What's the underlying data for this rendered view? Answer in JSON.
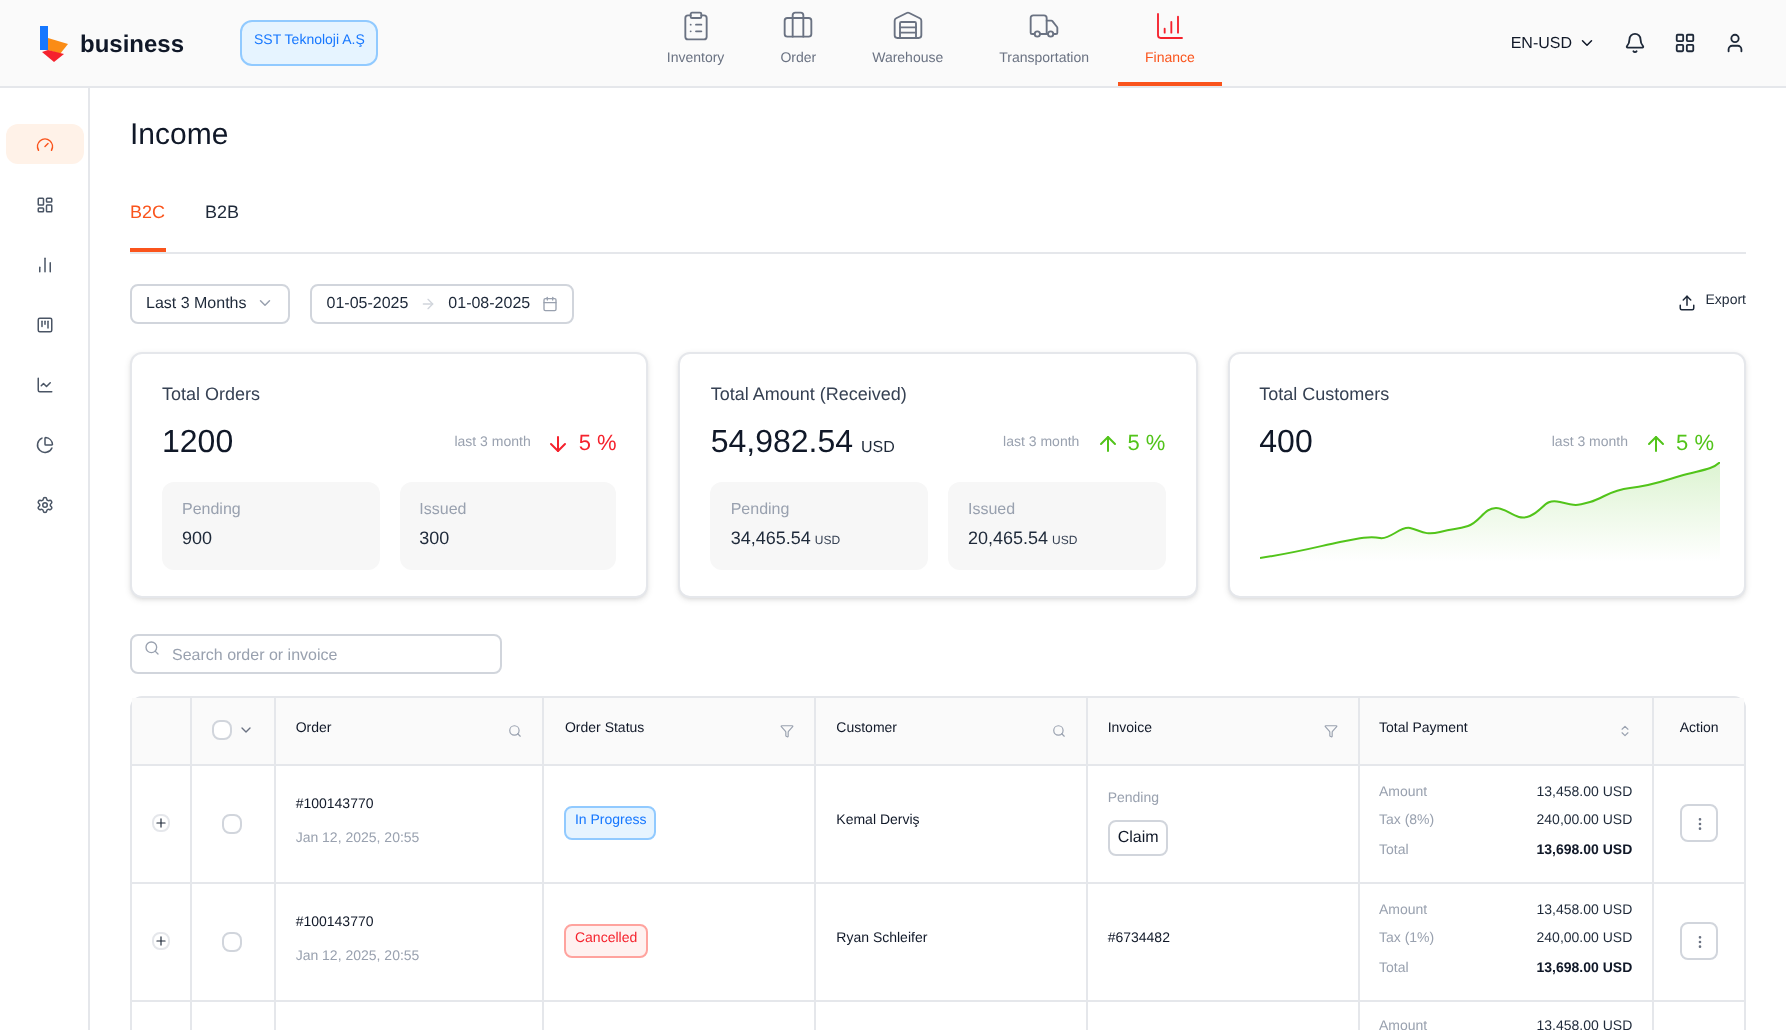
{
  "brand": {
    "name": "business",
    "company": "SST Teknoloji A.Ş"
  },
  "nav": [
    {
      "label": "Inventory",
      "selected": false
    },
    {
      "label": "Order",
      "selected": false
    },
    {
      "label": "Warehouse",
      "selected": false
    },
    {
      "label": "Transportation",
      "selected": false
    },
    {
      "label": "Finance",
      "selected": true
    }
  ],
  "locale": "EN-USD",
  "sidebar": {
    "items": [
      {
        "selected": true
      },
      {
        "selected": false
      },
      {
        "selected": false
      },
      {
        "selected": false
      },
      {
        "selected": false
      },
      {
        "selected": false
      },
      {
        "selected": false
      }
    ]
  },
  "page_title": "Income",
  "tabs": [
    {
      "label": "B2C",
      "selected": true
    },
    {
      "label": "B2B",
      "selected": false
    }
  ],
  "filters": {
    "period": "Last 3 Months",
    "date_from": "01-05-2025",
    "date_to": "01-08-2025",
    "export": "Export"
  },
  "cards": [
    {
      "title": "Total Orders",
      "value": "1200",
      "period": "last 3 month",
      "change": {
        "kind": "down",
        "text": "5 %"
      },
      "kind": "stats",
      "stats": [
        {
          "label": "Pending",
          "value": "900"
        },
        {
          "label": "Issued",
          "value": "300"
        }
      ]
    },
    {
      "title": "Total Amount (Received)",
      "value": "54,982.54",
      "unit": "USD",
      "period": "last 3 month",
      "change": {
        "kind": "up",
        "text": "5 %"
      },
      "kind": "stats",
      "stats": [
        {
          "label": "Pending",
          "value": "34,465.54",
          "unit": "USD"
        },
        {
          "label": "Issued",
          "value": "20,465.54",
          "unit": "USD"
        }
      ]
    },
    {
      "title": "Total Customers",
      "value": "400",
      "period": "last 3 month",
      "change": {
        "kind": "up",
        "text": "5 %"
      },
      "kind": "sparkline"
    }
  ],
  "search": {
    "placeholder": "Search order or invoice"
  },
  "table": {
    "select_all_checked": false,
    "columns": [
      "Order",
      "Order Status",
      "Customer",
      "Invoice",
      "Total Payment",
      "Action"
    ],
    "rows": [
      {
        "checked": false,
        "order": "#100143770",
        "date": "Jan 12, 2025, 20:55",
        "status": {
          "kind": "progress",
          "label": "In Progress"
        },
        "customer": "Kemal Derviş",
        "invoice": {
          "kind": "claim",
          "status": "Pending",
          "button": "Claim"
        },
        "payment": [
          {
            "label": "Amount",
            "value": "13,458.00 USD"
          },
          {
            "label": "Tax (8%)",
            "value": "240,00.00 USD"
          },
          {
            "label": "Total",
            "value": "13,698.00 USD"
          }
        ]
      },
      {
        "checked": false,
        "order": "#100143770",
        "date": "Jan 12, 2025, 20:55",
        "status": {
          "kind": "cancelled",
          "label": "Cancelled"
        },
        "customer": "Ryan Schleifer",
        "invoice": {
          "kind": "number",
          "number": "#6734482"
        },
        "payment": [
          {
            "label": "Amount",
            "value": "13,458.00 USD"
          },
          {
            "label": "Tax (1%)",
            "value": "240,00.00 USD"
          },
          {
            "label": "Total",
            "value": "13,698.00 USD"
          }
        ]
      },
      {
        "payment": [
          {
            "label": "Amount",
            "value": "13,458.00 USD"
          }
        ]
      }
    ]
  }
}
